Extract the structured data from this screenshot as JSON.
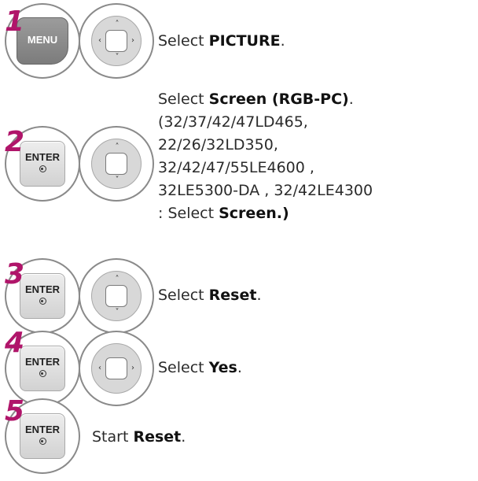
{
  "steps": [
    {
      "number": "1",
      "button_key": "MENU",
      "nav_arrows": [
        "up",
        "down",
        "left",
        "right"
      ],
      "prefix": "Select ",
      "bold": "PICTURE",
      "suffix": "."
    },
    {
      "number": "2",
      "button_key": "ENTER",
      "nav_arrows": [
        "up",
        "down"
      ],
      "prefix": "Select ",
      "bold": "Screen (RGB-PC)",
      "suffix": ".",
      "note_lines": [
        "(32/37/42/47LD465,",
        "22/26/32LD350,",
        "32/42/47/55LE4600 ,",
        "32LE5300-DA , 32/42LE4300"
      ],
      "note_last_prefix": ": Select ",
      "note_last_bold": "Screen.)"
    },
    {
      "number": "3",
      "button_key": "ENTER",
      "nav_arrows": [
        "up",
        "down"
      ],
      "prefix": "Select ",
      "bold": "Reset",
      "suffix": "."
    },
    {
      "number": "4",
      "button_key": "ENTER",
      "nav_arrows": [
        "left",
        "right"
      ],
      "prefix": "Select ",
      "bold": "Yes",
      "suffix": "."
    },
    {
      "number": "5",
      "button_key": "ENTER",
      "prefix": "Start ",
      "bold": "Reset",
      "suffix": "."
    }
  ],
  "icons": {
    "up": "chevron-up-icon",
    "down": "chevron-down-icon",
    "left": "chevron-left-icon",
    "right": "chevron-right-icon",
    "enter_dot": "circle-dot-icon"
  },
  "colors": {
    "step_number": "#b0156a",
    "menu_key": "#8c8c8c",
    "enter_key": "#e0e0e0",
    "text": "#2b2b2b"
  }
}
